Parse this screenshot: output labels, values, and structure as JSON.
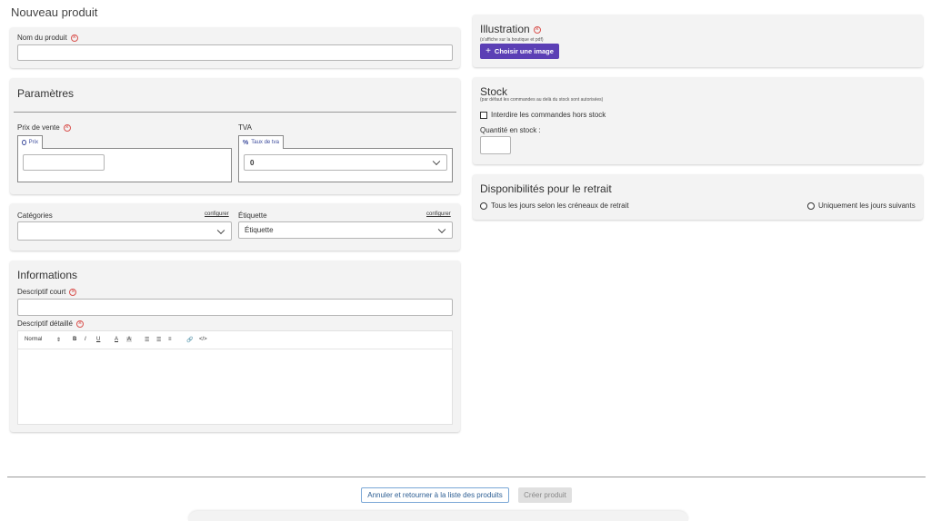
{
  "page": {
    "title": "Nouveau produit"
  },
  "name_card": {
    "label": "Nom du produit",
    "value": ""
  },
  "parametres": {
    "title": "Paramètres",
    "price_label": "Prix de vente",
    "price_tab": "Prix",
    "price_value": "",
    "tva_label": "TVA",
    "tva_tab": "Taux de tva",
    "tva_selected": "0"
  },
  "classification": {
    "categories_label": "Catégories",
    "categories_config": "configurer",
    "categories_selected": "",
    "etiquette_label": "Étiquette",
    "etiquette_config": "configurer",
    "etiquette_selected": "Étiquette"
  },
  "informations": {
    "title": "Informations",
    "short_label": "Descriptif court",
    "short_value": "",
    "detail_label": "Descriptif détaillé",
    "toolbar": {
      "style": "Normal",
      "style_arrows": "⇕",
      "bold": "B",
      "italic": "I",
      "underline": "U",
      "color": "A",
      "bg": "A",
      "ordered_list": "☰",
      "bullet_list": "☰",
      "align": "≡",
      "link": "🔗",
      "code": "</>"
    }
  },
  "illustration": {
    "title": "Illustration",
    "subtitle": "(s'affiche sur la boutique et pdf)",
    "button": "Choisir une image"
  },
  "stock": {
    "title": "Stock",
    "subtitle": "(par défaut les commandes au delà du stock sont autorisées)",
    "forbid_label": "Interdire les commandes hors stock",
    "qty_label": "Quantité en stock :",
    "qty_value": ""
  },
  "retrait": {
    "title": "Disponibilités pour le retrait",
    "option_all": "Tous les jours selon les créneaux de retrait",
    "option_some": "Uniquement les jours suivants"
  },
  "footer": {
    "cancel": "Annuler et retourner à la liste des produits",
    "create": "Créer produit"
  },
  "colors": {
    "primary": "#5b3fb5",
    "required": "#d9534f",
    "link": "#2d5e93"
  }
}
